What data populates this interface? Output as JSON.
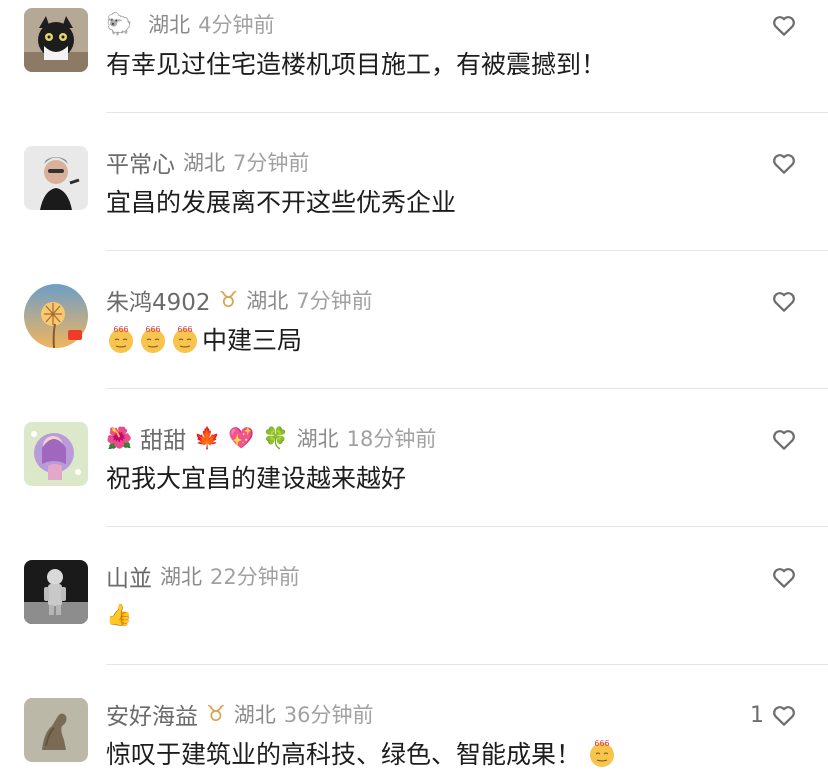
{
  "comments": [
    {
      "name": "",
      "emoji_name": "🐑",
      "location": "湖北",
      "time": "4分钟前",
      "text": "有幸见过住宅造楼机项目施工，有被震撼到！",
      "likes": ""
    },
    {
      "name": "平常心",
      "location": "湖北",
      "time": "7分钟前",
      "text": "宜昌的发展离不开这些优秀企业",
      "likes": ""
    },
    {
      "name": "朱鸿4902",
      "badge": "♉",
      "location": "湖北",
      "time": "7分钟前",
      "text": "中建三局",
      "likes": ""
    },
    {
      "name": "甜甜",
      "deco_left": "🌺",
      "deco_right_1": "🍁",
      "deco_right_2": "💖",
      "deco_right_3": "🍀",
      "location": "湖北",
      "time": "18分钟前",
      "text": "祝我大宜昌的建设越来越好",
      "likes": ""
    },
    {
      "name": "山並",
      "location": "湖北",
      "time": "22分钟前",
      "text": "",
      "emoji": "👍",
      "likes": ""
    },
    {
      "name": "安好海益",
      "badge": "♉",
      "location": "湖北",
      "time": "36分钟前",
      "text": "惊叹于建筑业的高科技、绿色、智能成果！",
      "likes": "1"
    }
  ],
  "colors": {
    "name": "#6b6b6b",
    "meta": "#8b8b8b",
    "text": "#1d1d1d",
    "divider": "#e6e6e6",
    "accent_gold": "#d7a24b"
  }
}
